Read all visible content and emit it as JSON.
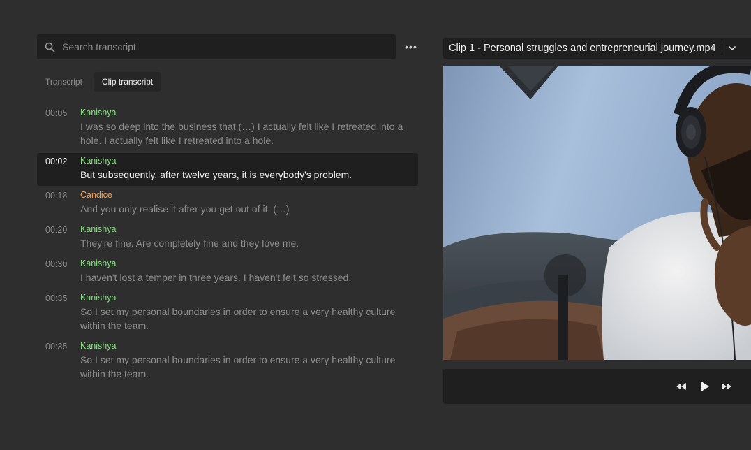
{
  "search": {
    "placeholder": "Search transcript"
  },
  "more_label": "•••",
  "tabs": [
    {
      "label": "Transcript",
      "active": false
    },
    {
      "label": "Clip transcript",
      "active": true
    }
  ],
  "transcript": [
    {
      "time": "00:05",
      "speaker": "Kanishya",
      "speaker_color": "#7ee07a",
      "text": "I was so deep into the business that (…) I actually felt like I retreated into a hole. I actually felt like I retreated into a hole.",
      "active": false
    },
    {
      "time": "00:02",
      "speaker": "Kanishya",
      "speaker_color": "#7ee07a",
      "text": "But subsequently, after twelve years, it is everybody's problem.",
      "active": true
    },
    {
      "time": "00:18",
      "speaker": "Candice",
      "speaker_color": "#f0a05a",
      "text": "And you only realise it after you get out of it. (…)",
      "active": false
    },
    {
      "time": "00:20",
      "speaker": "Kanishya",
      "speaker_color": "#7ee07a",
      "text": "They're fine. Are completely fine and they love me.",
      "active": false
    },
    {
      "time": "00:30",
      "speaker": "Kanishya",
      "speaker_color": "#7ee07a",
      "text": "I haven't lost a temper in three years. I haven't felt so stressed.",
      "active": false
    },
    {
      "time": "00:35",
      "speaker": "Kanishya",
      "speaker_color": "#7ee07a",
      "text": "So I set my personal boundaries in order to ensure a very healthy culture within the team.",
      "active": false
    },
    {
      "time": "00:35",
      "speaker": "Kanishya",
      "speaker_color": "#7ee07a",
      "text": "So I set my personal boundaries in order to ensure a very healthy culture within the team.",
      "active": false
    }
  ],
  "clip": {
    "title": "Clip 1 - Personal struggles and entrepreneurial journey.mp4"
  },
  "colors": {
    "background": "#2e2e2e",
    "panel": "#1f1f1f",
    "speaker_green": "#7ee07a",
    "speaker_orange": "#f0a05a"
  },
  "icons": {
    "search": "search-icon",
    "chevron": "chevron-down-icon",
    "rewind": "rewind-icon",
    "play": "play-icon",
    "forward": "fast-forward-icon"
  }
}
